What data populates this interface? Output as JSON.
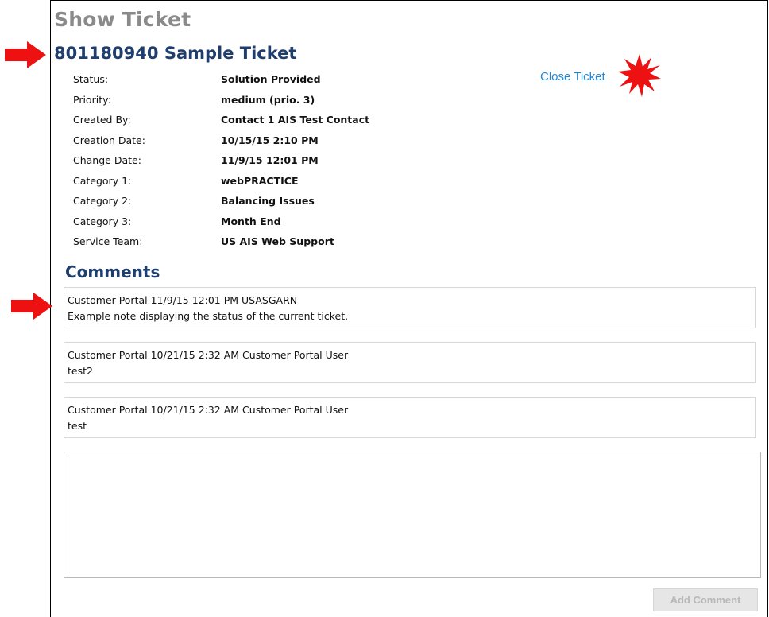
{
  "page": {
    "title": "Show Ticket",
    "ticket_title": "801180940 Sample Ticket",
    "close_ticket_label": "Close Ticket"
  },
  "details": [
    {
      "label": "Status:",
      "value": "Solution Provided"
    },
    {
      "label": "Priority:",
      "value": "medium (prio. 3)"
    },
    {
      "label": "Created By:",
      "value": "Contact 1 AIS Test Contact"
    },
    {
      "label": "Creation Date:",
      "value": "10/15/15 2:10 PM"
    },
    {
      "label": "Change Date:",
      "value": "11/9/15 12:01 PM"
    },
    {
      "label": "Category 1:",
      "value": "webPRACTICE"
    },
    {
      "label": "Category 2:",
      "value": "Balancing Issues"
    },
    {
      "label": "Category 3:",
      "value": "Month End"
    },
    {
      "label": "Service Team:",
      "value": "US AIS Web Support"
    }
  ],
  "comments": {
    "heading": "Comments",
    "items": [
      {
        "header": "Customer Portal 11/9/15 12:01 PM USASGARN",
        "text": "Example note displaying the status of the current ticket."
      },
      {
        "header": "Customer Portal 10/21/15 2:32 AM Customer Portal User",
        "text": "test2"
      },
      {
        "header": "Customer Portal 10/21/15 2:32 AM Customer Portal User",
        "text": "test"
      }
    ],
    "new_comment_value": "",
    "add_comment_label": "Add Comment"
  },
  "colors": {
    "title_gray": "#8a8a8a",
    "heading_navy": "#1f3e6e",
    "link_blue": "#1e88d8",
    "annotation_red": "#ee1111",
    "button_disabled_bg": "#e6e6e6"
  },
  "icons": {
    "annotation_arrow": "arrow-right-icon",
    "annotation_star": "starburst-icon"
  }
}
